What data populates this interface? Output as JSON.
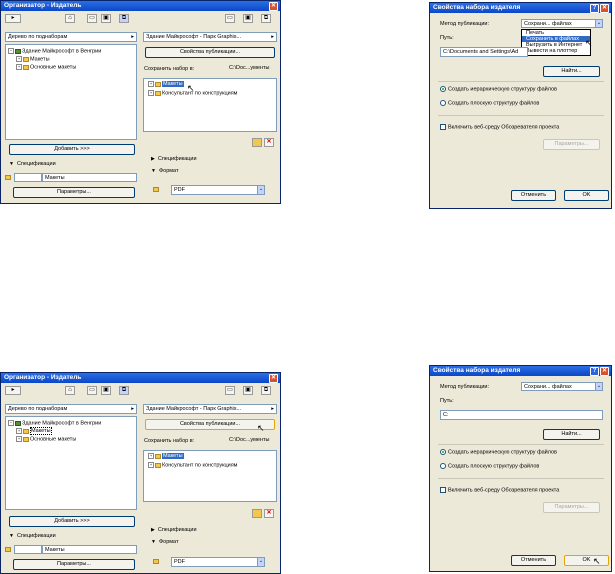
{
  "organizer": {
    "title": "Организатор - Издатель",
    "close": "✕",
    "left_dropdown": "Дерево по поднаборам",
    "tree": {
      "root": "Здание Майкрософт в Венгрии",
      "child1": "Макеты",
      "child2": "Основные макеты"
    },
    "add_button": "Добавить >>>",
    "spec_label": "Спецификации",
    "spec_value": "Макеты",
    "params_button": "Параметры...",
    "right_dropdown": "Здание Майкрософт - Парк Graphis...",
    "props_button": "Свойства публикации...",
    "save_set_label": "Сохранить набор в:",
    "save_set_path": "C:\\Doc...ументы",
    "pub_tree": {
      "item1": "Макеты",
      "item2": "Консультант по конструкциям"
    },
    "section_spec": "Спецификации",
    "section_format": "Формат",
    "format_value": "PDF"
  },
  "props": {
    "title": "Свойства набора издателя",
    "help": "?",
    "close": "✕",
    "method_label": "Метод публикации:",
    "method_value": "Сохрани... файлах",
    "menu_items": [
      "Печать",
      "Сохранить в файлах",
      "Выгрузить в Интернет",
      "Вывести на плоттер"
    ],
    "path_label": "Путь:",
    "path_value_top": "C:\\Documents and Settings\\Ad",
    "path_value_bottom": "C:",
    "find_button": "Найти...",
    "radio1": "Создать иерархическую структуру файлов",
    "radio2": "Создать плоскую структуру файлов",
    "checkbox": "Включить веб-среду Обозревателя проекта",
    "params_button": "Параметры...",
    "cancel_button": "Отменить",
    "ok_button": "OK"
  },
  "colors": {
    "title_bar": "#0a47c8",
    "window_bg": "#ece9d8",
    "selection": "#316ac5"
  }
}
